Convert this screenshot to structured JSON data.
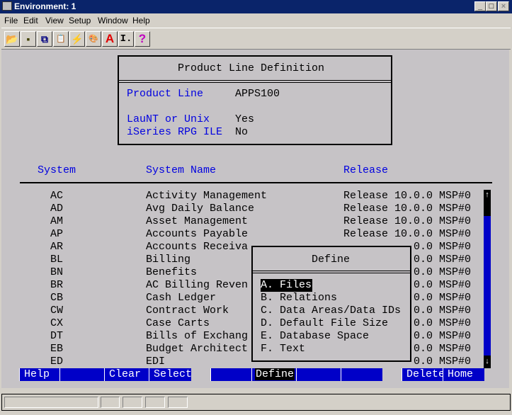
{
  "window": {
    "title": "Environment: 1",
    "buttons": [
      "_",
      "□",
      "×"
    ]
  },
  "menu": [
    "File",
    "Edit",
    "View",
    "Setup",
    "Window",
    "Help"
  ],
  "toolbar": [
    {
      "icon": "open-folder-icon",
      "glyph": "📂"
    },
    {
      "icon": "save-disk-icon",
      "glyph": "▪"
    },
    {
      "icon": "copy-icon",
      "glyph": "⧉"
    },
    {
      "icon": "paste-icon",
      "glyph": "📋"
    },
    {
      "icon": "macro-icon",
      "glyph": "⚡"
    },
    {
      "icon": "palette-icon",
      "glyph": "🎨"
    },
    {
      "icon": "font-icon",
      "glyph": "A"
    },
    {
      "icon": "cursor-icon",
      "glyph": "I."
    },
    {
      "icon": "help-icon",
      "glyph": "?"
    }
  ],
  "product_box": {
    "title": "Product Line Definition",
    "fields": [
      {
        "label": "Product Line",
        "value": "APPS100"
      },
      {
        "label": "LauNT or Unix",
        "value": "Yes"
      },
      {
        "label": "iSeries RPG ILE",
        "value": "No"
      }
    ]
  },
  "table": {
    "headers": [
      "System",
      "System Name",
      "Release"
    ],
    "rows": [
      [
        "AC",
        "Activity Management",
        "Release 10.0.0 MSP#0"
      ],
      [
        "AD",
        "Avg Daily Balance",
        "Release 10.0.0 MSP#0"
      ],
      [
        "AM",
        "Asset Management",
        "Release 10.0.0 MSP#0"
      ],
      [
        "AP",
        "Accounts Payable",
        "Release 10.0.0 MSP#0"
      ],
      [
        "AR",
        "Accounts Receiva",
        "0.0 MSP#0"
      ],
      [
        "BL",
        "Billing",
        "0.0 MSP#0"
      ],
      [
        "BN",
        "Benefits",
        "0.0 MSP#0"
      ],
      [
        "BR",
        "AC Billing Reven",
        "0.0 MSP#0"
      ],
      [
        "CB",
        "Cash Ledger",
        "0.0 MSP#0"
      ],
      [
        "CW",
        "Contract Work",
        "0.0 MSP#0"
      ],
      [
        "CX",
        "Case Carts",
        "0.0 MSP#0"
      ],
      [
        "DT",
        "Bills of Exchang",
        "0.0 MSP#0"
      ],
      [
        "EB",
        "Budget Architect",
        "0.0 MSP#0"
      ],
      [
        "ED",
        "EDI",
        "0.0 MSP#0"
      ]
    ]
  },
  "define_popup": {
    "title": "Define",
    "items": [
      "A. Files",
      "B. Relations",
      "C. Data Areas/Data IDs",
      "D. Default File Size",
      "E. Database Space",
      "F. Text"
    ],
    "selected": 0
  },
  "function_keys": [
    "Help",
    "",
    "Clear",
    "Select",
    "",
    "Define",
    "",
    "",
    "Delete",
    "Home"
  ],
  "colors": {
    "label_blue": "#0000e0",
    "fkey_blue": "#0000c8",
    "titlebar": "#0a246a",
    "terminal_bg": "#c6c3c6"
  }
}
